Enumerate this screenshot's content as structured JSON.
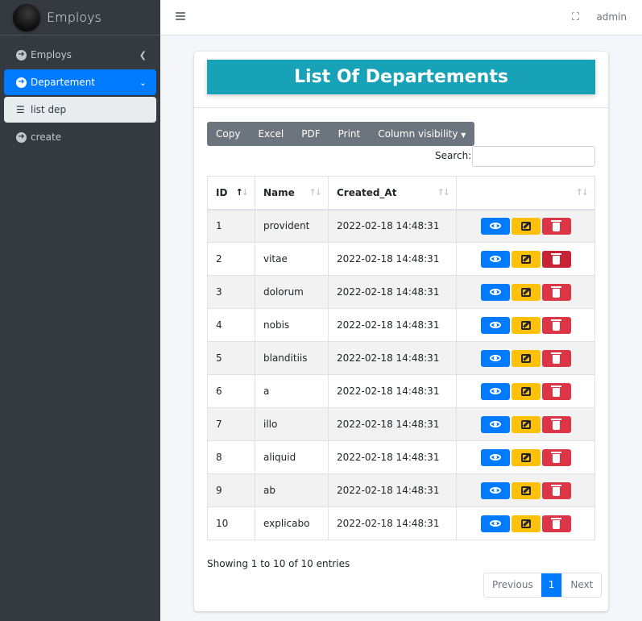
{
  "brand": {
    "name": "Employs"
  },
  "sidebar": {
    "items": [
      {
        "label": "Employs"
      },
      {
        "label": "Departement"
      },
      {
        "label": "list dep"
      },
      {
        "label": "create"
      }
    ]
  },
  "topbar": {
    "user": "admin"
  },
  "card": {
    "title": "List Of Departements"
  },
  "toolbar": {
    "copy": "Copy",
    "excel": "Excel",
    "pdf": "PDF",
    "print": "Print",
    "column_visibility": "Column visibility"
  },
  "search": {
    "label": "Search:",
    "value": ""
  },
  "table": {
    "headers": [
      "ID",
      "Name",
      "Created_At",
      ""
    ],
    "rows": [
      {
        "id": "1",
        "name": "provident",
        "created_at": "2022-02-18 14:48:31"
      },
      {
        "id": "2",
        "name": "vitae",
        "created_at": "2022-02-18 14:48:31"
      },
      {
        "id": "3",
        "name": "dolorum",
        "created_at": "2022-02-18 14:48:31"
      },
      {
        "id": "4",
        "name": "nobis",
        "created_at": "2022-02-18 14:48:31"
      },
      {
        "id": "5",
        "name": "blanditiis",
        "created_at": "2022-02-18 14:48:31"
      },
      {
        "id": "6",
        "name": "a",
        "created_at": "2022-02-18 14:48:31"
      },
      {
        "id": "7",
        "name": "illo",
        "created_at": "2022-02-18 14:48:31"
      },
      {
        "id": "8",
        "name": "aliquid",
        "created_at": "2022-02-18 14:48:31"
      },
      {
        "id": "9",
        "name": "ab",
        "created_at": "2022-02-18 14:48:31"
      },
      {
        "id": "10",
        "name": "explicabo",
        "created_at": "2022-02-18 14:48:31"
      }
    ]
  },
  "footer": {
    "info": "Showing 1 to 10 of 10 entries",
    "previous": "Previous",
    "current_page": "1",
    "next": "Next"
  },
  "colors": {
    "sidebar_bg": "#343a40",
    "active_blue": "#007bff",
    "title_teal": "#17a2b8",
    "warning": "#ffc107",
    "danger": "#dc3545"
  },
  "icons": [
    "hamburger-icon",
    "expand-icon",
    "arrow-circle-right-icon",
    "list-icon",
    "eye-icon",
    "edit-icon",
    "trash-icon"
  ]
}
